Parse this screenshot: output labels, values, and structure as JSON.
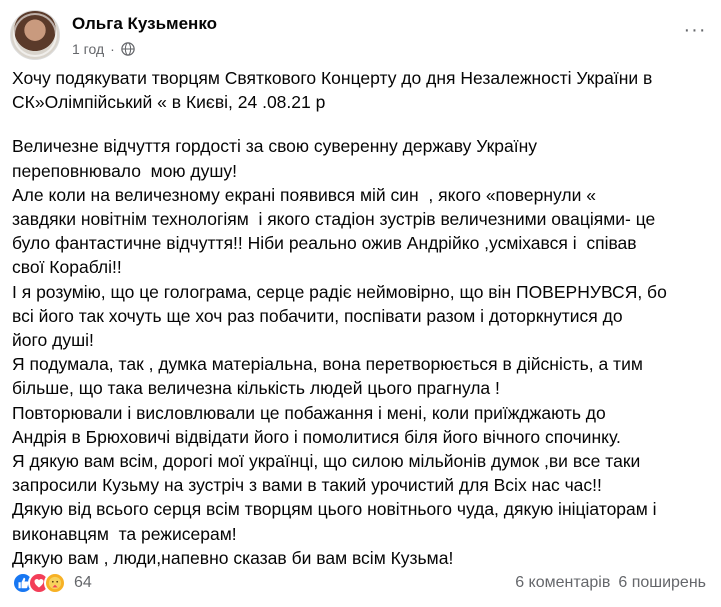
{
  "post": {
    "author": "Ольга Кузьменко",
    "time": "1 год",
    "visibility_icon": "globe-icon",
    "more_label": "···",
    "paragraphs": [
      "Хочу подякувати творцям Святкового Концерту до дня Незалежності України в\nСК»Олімпійський « в Києві, 24 .08.21 р",
      "Величезне відчуття гордості за свою суверенну державу Україну\nпереповнювало  мою душу!\nАле коли на величезному екрані появився мій син  , якого «повернули «\nзавдяки новітнім технологіям  і якого стадіон зустрів величезними оваціями- це\nбуло фантастичне відчуття!! Ніби реально ожив Андрійко ,усміхався і  співав\nсвої Кораблі!!\nІ я розумію, що це гологрaма, серце радіє неймовірно, що він ПОВЕРНУВСЯ, бо\nвсі його так хочуть ще хоч раз побачити, поспівати разом і доторкнутися до\nйого душі!\nЯ подумала, так , думка матеріальна, вона перетворюється в дійсність, а тим\nбільше, що така величезна кількість людей цього прагнула !\nПовторювали і висловлювали це побажання і мені, коли приїжджають до\nАндрія в Брюховичі відвідати його і помолитися біля його вічного спочинку.\nЯ дякую вам всім, дорогі мої українці, що силою мільйонів думок ,ви все таки\nзапросили Кузьму на зустріч з вами в такий урочистий для Всіх нас час!!\nДякую від всього серця всім творцям цього новітнього чуда, дякую ініціаторам і\nвиконавцям  та режисерам!\nДякую вам , люди,напевно сказав би вам всім Кузьма!"
    ]
  },
  "footer": {
    "reaction_icons": [
      "like-icon",
      "love-icon",
      "care-icon"
    ],
    "reaction_count": "64",
    "comments": "6 коментарів",
    "shares": "6 поширень"
  },
  "colors": {
    "like": "#1877f2",
    "love": "#f33e58",
    "care": "#f7b125",
    "secondary_text": "#65676b"
  }
}
